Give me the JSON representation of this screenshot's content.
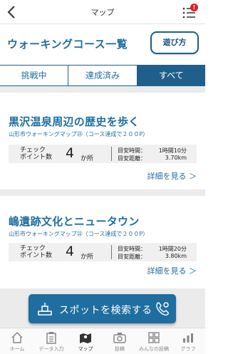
{
  "header": {
    "title": "マップ",
    "badge": "!"
  },
  "page": {
    "title": "ウォーキングコース一覧",
    "howto_label": "遊び方"
  },
  "tabs": [
    {
      "label": "挑戦中"
    },
    {
      "label": "達成済み"
    },
    {
      "label": "すべて"
    }
  ],
  "courses": [
    {
      "title": "黒沢温泉周辺の歴史を歩く",
      "subtitle": "山形市ウォーキングマップ㉓（コース達成で２００P）",
      "check_label_1": "チェック",
      "check_label_2": "ポイント数",
      "check_count": "4",
      "check_unit": "か所",
      "time_label": "目安時間：",
      "time_value": "1時間10分",
      "distance_label": "目安距離：",
      "distance_value": "3.70km",
      "detail_label": "詳細を見る ＞"
    },
    {
      "title": "嶋遺跡文化とニュータウン",
      "subtitle": "山形市ウォーキングマップ㉒（コース達成で２００P）",
      "check_label_1": "チェック",
      "check_label_2": "ポイント数",
      "check_count": "4",
      "check_unit": "か所",
      "time_label": "目安時間：",
      "time_value": "1時間20分",
      "distance_label": "目安距離：",
      "distance_value": "3.80km",
      "detail_label": "詳細を見る ＞"
    }
  ],
  "search_button": {
    "label": "スポットを検索する"
  },
  "bottom_nav": [
    {
      "label": "ホーム",
      "icon": "home-icon"
    },
    {
      "label": "データ入力",
      "icon": "clipboard-icon"
    },
    {
      "label": "マップ",
      "icon": "map-icon"
    },
    {
      "label": "投稿",
      "icon": "camera-icon"
    },
    {
      "label": "みんなの投稿",
      "icon": "grid-icon"
    },
    {
      "label": "グラフ",
      "icon": "chart-icon"
    }
  ],
  "colors": {
    "primary": "#1f6ea0",
    "tab_active": "#1f5f8b",
    "badge": "#e02020"
  }
}
